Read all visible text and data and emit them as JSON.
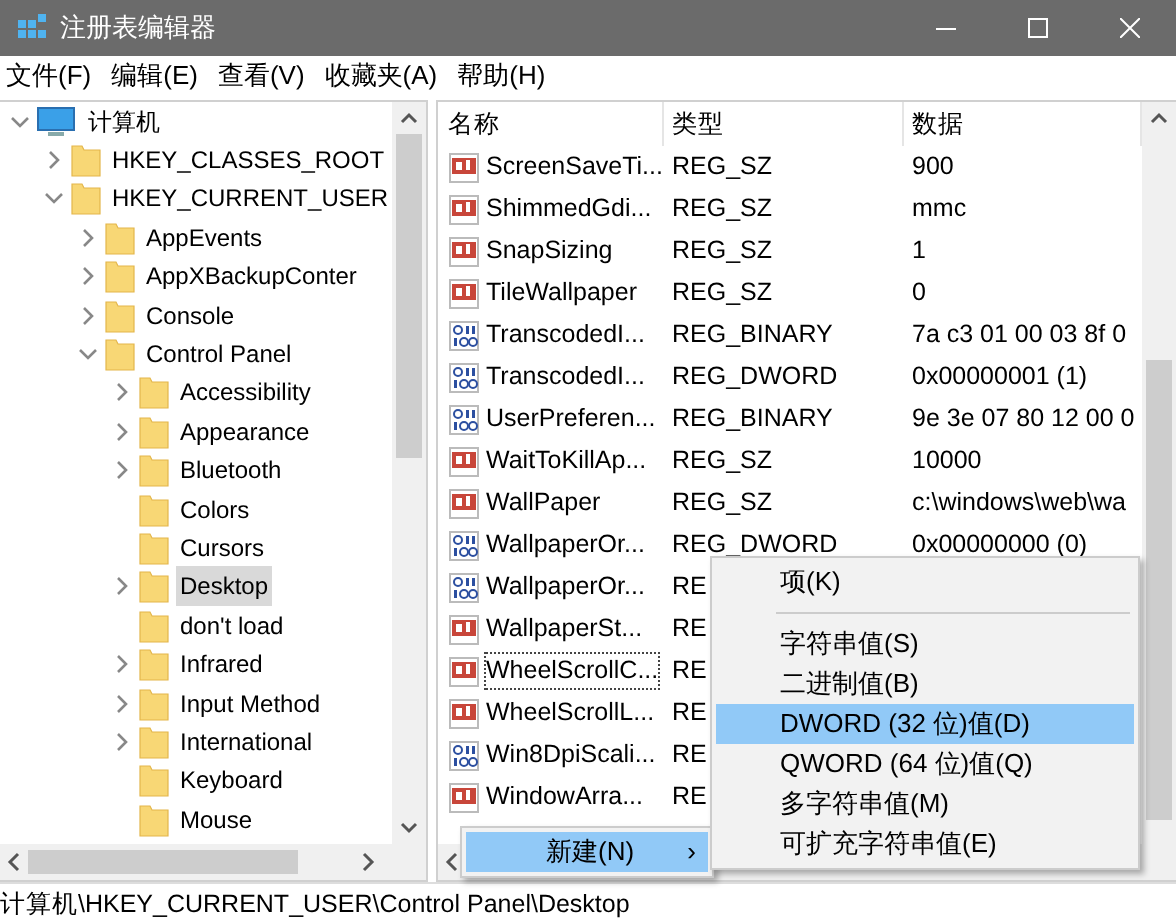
{
  "window": {
    "title": "注册表编辑器"
  },
  "menu": [
    "文件(F)",
    "编辑(E)",
    "查看(V)",
    "收藏夹(A)",
    "帮助(H)"
  ],
  "tree": [
    {
      "label": "计算机",
      "kind": "computer",
      "expanded": true,
      "selected": false,
      "children": [
        {
          "label": "HKEY_CLASSES_ROOT",
          "kind": "branch",
          "expanded": false,
          "selected": false
        },
        {
          "label": "HKEY_CURRENT_USER",
          "kind": "branch",
          "expanded": true,
          "selected": false,
          "children": [
            {
              "label": "AppEvents",
              "kind": "branch",
              "expanded": false,
              "selected": false
            },
            {
              "label": "AppXBackupConter",
              "kind": "branch",
              "expanded": false,
              "selected": false
            },
            {
              "label": "Console",
              "kind": "branch",
              "expanded": false,
              "selected": false
            },
            {
              "label": "Control Panel",
              "kind": "branch",
              "expanded": true,
              "selected": false,
              "children": [
                {
                  "label": "Accessibility",
                  "kind": "branch",
                  "expanded": false,
                  "selected": false
                },
                {
                  "label": "Appearance",
                  "kind": "branch",
                  "expanded": false,
                  "selected": false
                },
                {
                  "label": "Bluetooth",
                  "kind": "branch",
                  "expanded": false,
                  "selected": false
                },
                {
                  "label": "Colors",
                  "kind": "leaf",
                  "selected": false
                },
                {
                  "label": "Cursors",
                  "kind": "leaf",
                  "selected": false
                },
                {
                  "label": "Desktop",
                  "kind": "branch",
                  "expanded": false,
                  "selected": true
                },
                {
                  "label": "don't load",
                  "kind": "leaf",
                  "selected": false
                },
                {
                  "label": "Infrared",
                  "kind": "branch",
                  "expanded": false,
                  "selected": false
                },
                {
                  "label": "Input Method",
                  "kind": "branch",
                  "expanded": false,
                  "selected": false
                },
                {
                  "label": "International",
                  "kind": "branch",
                  "expanded": false,
                  "selected": false
                },
                {
                  "label": "Keyboard",
                  "kind": "leaf",
                  "selected": false
                },
                {
                  "label": "Mouse",
                  "kind": "leaf",
                  "selected": false
                }
              ]
            }
          ]
        }
      ]
    }
  ],
  "table": {
    "columns": [
      "名称",
      "类型",
      "数据"
    ],
    "rows": [
      {
        "kind": "string",
        "name": "ScreenSaveTi...",
        "type": "REG_SZ",
        "data": "900",
        "focused": false
      },
      {
        "kind": "string",
        "name": "ShimmedGdi...",
        "type": "REG_SZ",
        "data": "mmc",
        "focused": false
      },
      {
        "kind": "string",
        "name": "SnapSizing",
        "type": "REG_SZ",
        "data": "1",
        "focused": false
      },
      {
        "kind": "string",
        "name": "TileWallpaper",
        "type": "REG_SZ",
        "data": "0",
        "focused": false
      },
      {
        "kind": "binary",
        "name": "TranscodedI...",
        "type": "REG_BINARY",
        "data": "7a c3 01 00 03 8f 0",
        "focused": false
      },
      {
        "kind": "binary",
        "name": "TranscodedI...",
        "type": "REG_DWORD",
        "data": "0x00000001 (1)",
        "focused": false
      },
      {
        "kind": "binary",
        "name": "UserPreferen...",
        "type": "REG_BINARY",
        "data": "9e 3e 07 80 12 00 0",
        "focused": false
      },
      {
        "kind": "string",
        "name": "WaitToKillAp...",
        "type": "REG_SZ",
        "data": "10000",
        "focused": false
      },
      {
        "kind": "string",
        "name": "WallPaper",
        "type": "REG_SZ",
        "data": "c:\\windows\\web\\wa",
        "focused": false
      },
      {
        "kind": "binary",
        "name": "WallpaperOr...",
        "type": "REG_DWORD",
        "data": "0x00000000 (0)",
        "focused": false
      },
      {
        "kind": "binary",
        "name": "WallpaperOr...",
        "type": "RE",
        "focused": false
      },
      {
        "kind": "string",
        "name": "WallpaperSt...",
        "type": "RE",
        "focused": false
      },
      {
        "kind": "string",
        "name": "WheelScrollC...",
        "type": "RE",
        "focused": true
      },
      {
        "kind": "string",
        "name": "WheelScrollL...",
        "type": "RE",
        "focused": false
      },
      {
        "kind": "binary",
        "name": "Win8DpiScali...",
        "type": "RE",
        "focused": false
      },
      {
        "kind": "string",
        "name": "WindowArra...",
        "type": "RE",
        "focused": false
      }
    ]
  },
  "context_menu": {
    "parent": {
      "label": "新建(N)",
      "arrow": "›",
      "selected": true
    },
    "items": [
      {
        "kind": "item",
        "label": "项(K)",
        "selected": false
      },
      {
        "kind": "separator"
      },
      {
        "kind": "item",
        "label": "字符串值(S)",
        "selected": false
      },
      {
        "kind": "item",
        "label": "二进制值(B)",
        "selected": false
      },
      {
        "kind": "item",
        "label": "DWORD (32 位)值(D)",
        "selected": true
      },
      {
        "kind": "item",
        "label": "QWORD (64 位)值(Q)",
        "selected": false
      },
      {
        "kind": "item",
        "label": "多字符串值(M)",
        "selected": false
      },
      {
        "kind": "item",
        "label": "可扩充字符串值(E)",
        "selected": false
      }
    ]
  },
  "status_bar": "计算机\\HKEY_CURRENT_USER\\Control Panel\\Desktop"
}
